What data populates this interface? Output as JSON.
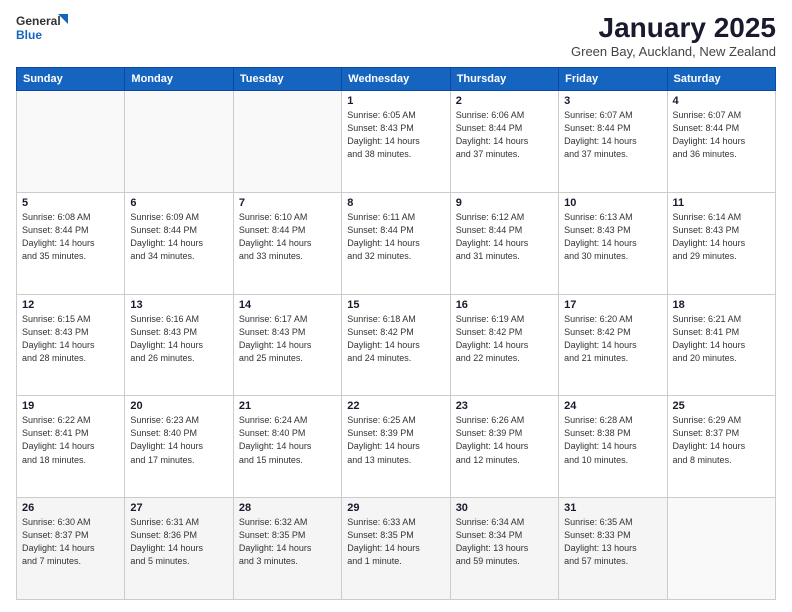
{
  "logo": {
    "general": "General",
    "blue": "Blue"
  },
  "header": {
    "title": "January 2025",
    "subtitle": "Green Bay, Auckland, New Zealand"
  },
  "days_of_week": [
    "Sunday",
    "Monday",
    "Tuesday",
    "Wednesday",
    "Thursday",
    "Friday",
    "Saturday"
  ],
  "weeks": [
    [
      {
        "day": "",
        "info": ""
      },
      {
        "day": "",
        "info": ""
      },
      {
        "day": "",
        "info": ""
      },
      {
        "day": "1",
        "info": "Sunrise: 6:05 AM\nSunset: 8:43 PM\nDaylight: 14 hours\nand 38 minutes."
      },
      {
        "day": "2",
        "info": "Sunrise: 6:06 AM\nSunset: 8:44 PM\nDaylight: 14 hours\nand 37 minutes."
      },
      {
        "day": "3",
        "info": "Sunrise: 6:07 AM\nSunset: 8:44 PM\nDaylight: 14 hours\nand 37 minutes."
      },
      {
        "day": "4",
        "info": "Sunrise: 6:07 AM\nSunset: 8:44 PM\nDaylight: 14 hours\nand 36 minutes."
      }
    ],
    [
      {
        "day": "5",
        "info": "Sunrise: 6:08 AM\nSunset: 8:44 PM\nDaylight: 14 hours\nand 35 minutes."
      },
      {
        "day": "6",
        "info": "Sunrise: 6:09 AM\nSunset: 8:44 PM\nDaylight: 14 hours\nand 34 minutes."
      },
      {
        "day": "7",
        "info": "Sunrise: 6:10 AM\nSunset: 8:44 PM\nDaylight: 14 hours\nand 33 minutes."
      },
      {
        "day": "8",
        "info": "Sunrise: 6:11 AM\nSunset: 8:44 PM\nDaylight: 14 hours\nand 32 minutes."
      },
      {
        "day": "9",
        "info": "Sunrise: 6:12 AM\nSunset: 8:44 PM\nDaylight: 14 hours\nand 31 minutes."
      },
      {
        "day": "10",
        "info": "Sunrise: 6:13 AM\nSunset: 8:43 PM\nDaylight: 14 hours\nand 30 minutes."
      },
      {
        "day": "11",
        "info": "Sunrise: 6:14 AM\nSunset: 8:43 PM\nDaylight: 14 hours\nand 29 minutes."
      }
    ],
    [
      {
        "day": "12",
        "info": "Sunrise: 6:15 AM\nSunset: 8:43 PM\nDaylight: 14 hours\nand 28 minutes."
      },
      {
        "day": "13",
        "info": "Sunrise: 6:16 AM\nSunset: 8:43 PM\nDaylight: 14 hours\nand 26 minutes."
      },
      {
        "day": "14",
        "info": "Sunrise: 6:17 AM\nSunset: 8:43 PM\nDaylight: 14 hours\nand 25 minutes."
      },
      {
        "day": "15",
        "info": "Sunrise: 6:18 AM\nSunset: 8:42 PM\nDaylight: 14 hours\nand 24 minutes."
      },
      {
        "day": "16",
        "info": "Sunrise: 6:19 AM\nSunset: 8:42 PM\nDaylight: 14 hours\nand 22 minutes."
      },
      {
        "day": "17",
        "info": "Sunrise: 6:20 AM\nSunset: 8:42 PM\nDaylight: 14 hours\nand 21 minutes."
      },
      {
        "day": "18",
        "info": "Sunrise: 6:21 AM\nSunset: 8:41 PM\nDaylight: 14 hours\nand 20 minutes."
      }
    ],
    [
      {
        "day": "19",
        "info": "Sunrise: 6:22 AM\nSunset: 8:41 PM\nDaylight: 14 hours\nand 18 minutes."
      },
      {
        "day": "20",
        "info": "Sunrise: 6:23 AM\nSunset: 8:40 PM\nDaylight: 14 hours\nand 17 minutes."
      },
      {
        "day": "21",
        "info": "Sunrise: 6:24 AM\nSunset: 8:40 PM\nDaylight: 14 hours\nand 15 minutes."
      },
      {
        "day": "22",
        "info": "Sunrise: 6:25 AM\nSunset: 8:39 PM\nDaylight: 14 hours\nand 13 minutes."
      },
      {
        "day": "23",
        "info": "Sunrise: 6:26 AM\nSunset: 8:39 PM\nDaylight: 14 hours\nand 12 minutes."
      },
      {
        "day": "24",
        "info": "Sunrise: 6:28 AM\nSunset: 8:38 PM\nDaylight: 14 hours\nand 10 minutes."
      },
      {
        "day": "25",
        "info": "Sunrise: 6:29 AM\nSunset: 8:37 PM\nDaylight: 14 hours\nand 8 minutes."
      }
    ],
    [
      {
        "day": "26",
        "info": "Sunrise: 6:30 AM\nSunset: 8:37 PM\nDaylight: 14 hours\nand 7 minutes."
      },
      {
        "day": "27",
        "info": "Sunrise: 6:31 AM\nSunset: 8:36 PM\nDaylight: 14 hours\nand 5 minutes."
      },
      {
        "day": "28",
        "info": "Sunrise: 6:32 AM\nSunset: 8:35 PM\nDaylight: 14 hours\nand 3 minutes."
      },
      {
        "day": "29",
        "info": "Sunrise: 6:33 AM\nSunset: 8:35 PM\nDaylight: 14 hours\nand 1 minute."
      },
      {
        "day": "30",
        "info": "Sunrise: 6:34 AM\nSunset: 8:34 PM\nDaylight: 13 hours\nand 59 minutes."
      },
      {
        "day": "31",
        "info": "Sunrise: 6:35 AM\nSunset: 8:33 PM\nDaylight: 13 hours\nand 57 minutes."
      },
      {
        "day": "",
        "info": ""
      }
    ]
  ]
}
